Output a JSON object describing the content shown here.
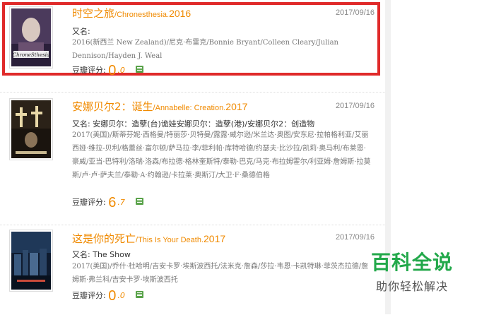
{
  "movies": [
    {
      "title_cn": "时空之旅",
      "title_en": "/Chronesthesia.",
      "year": "2016",
      "date": "2017/09/16",
      "aka_label": "又名:",
      "aka_value": "",
      "cast": "2016(新西兰 New Zealand)/尼克·布雷克/Bonnie Bryant/Colleen Cleary/Julian Dennison/Hayden J. Weal",
      "rating_label": "豆瓣评分:",
      "rating_int": "0",
      "rating_dec": ".0"
    },
    {
      "title_cn": "安娜贝尔2：诞生",
      "title_en": "/Annabelle: Creation.",
      "year": "2017",
      "date": "2017/09/16",
      "aka_label": "又名:",
      "aka_value": "安娜贝尔：造孽(台)诡娃安娜贝尔：造孽(港)/安娜贝尔2：创造物",
      "cast": "2017(美国)/斯蒂芬妮·西格曼/特丽莎·贝特曼/露露·威尔逊/米兰达·奥图/安东尼·拉帕格利亚/艾丽西娅·维拉-贝利/格蕾丝·富尔顿/萨马拉·李/菲利帕·库特哈德/约瑟夫·比沙拉/凯莉·奥马利/布莱恩·豪威/亚当·巴特利/洛瑞·洛森/布拉德·格林奎斯特/泰勒·巴克/马克·布拉姆霍尔/利亚姆·詹姆斯·拉莫斯/卢·卢·萨夫兰/泰勒·A·约翰逊/卡拉莱·奥斯汀/大卫·F·桑德伯格",
      "rating_label": "豆瓣评分:",
      "rating_int": "6",
      "rating_dec": ".7"
    },
    {
      "title_cn": "这是你的死亡",
      "title_en": "/This Is Your Death.",
      "year": "2017",
      "date": "2017/09/16",
      "aka_label": "又名:",
      "aka_value": "The Show",
      "cast": "2017(美国)/乔什·杜哈明/吉安卡罗·埃斯波西托/法米克·詹森/莎拉·韦恩·卡凯特琳·菲茨杰拉德/詹姆斯·弗兰科/吉安卡罗·埃斯波西托",
      "rating_label": "豆瓣评分:",
      "rating_int": "0",
      "rating_dec": ".0"
    }
  ],
  "poster_text": "ChroneSthesia",
  "watermark": {
    "main": "百科全说",
    "sub": "助你轻松解决"
  },
  "colors": {
    "accent": "#f08a00",
    "highlight": "#e02a2a",
    "brand": "#22a84a"
  }
}
